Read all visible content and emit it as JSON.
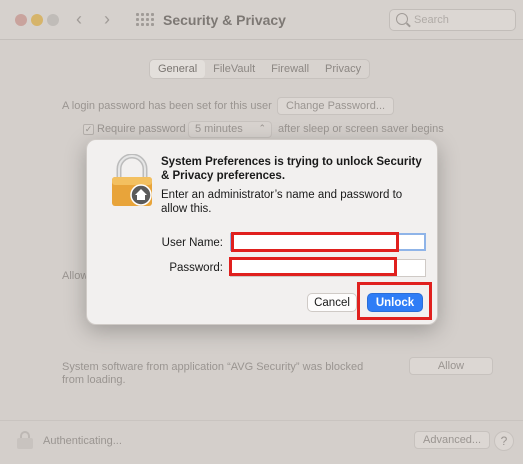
{
  "window": {
    "title": "Security & Privacy",
    "search_placeholder": "Search",
    "tabs": [
      {
        "label": "General",
        "selected": true
      },
      {
        "label": "FileVault",
        "selected": false
      },
      {
        "label": "Firewall",
        "selected": false
      },
      {
        "label": "Privacy",
        "selected": false
      }
    ],
    "login_text": "A login password has been set for this user",
    "change_password_label": "Change Password...",
    "require_password_label": "Require password",
    "require_password_value": "5 minutes",
    "after_sleep_text": "after sleep or screen saver begins",
    "allow_text": "Allow",
    "blocked_text_line1": "System software from application “AVG Security” was blocked",
    "blocked_text_line2": "from loading.",
    "allow_button_label": "Allow",
    "authenticating_text": "Authenticating...",
    "advanced_label": "Advanced...",
    "help_label": "?"
  },
  "dialog": {
    "title": "System Preferences is trying to unlock Security & Privacy preferences.",
    "message": "Enter an administrator’s name and password to allow this.",
    "username_label": "User Name:",
    "username_value": "",
    "password_label": "Password:",
    "password_value": "",
    "cancel_label": "Cancel",
    "unlock_label": "Unlock"
  },
  "colors": {
    "accent": "#2f7df6",
    "highlight": "#e0201e"
  }
}
